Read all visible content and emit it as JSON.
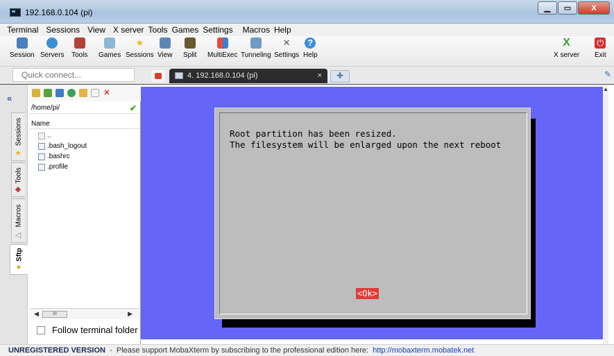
{
  "window": {
    "title": "192.168.0.104 (pi)",
    "minimize": "▁",
    "maximize": "▭",
    "close": "X"
  },
  "menu": [
    "Terminal",
    "Sessions",
    "View",
    "X server",
    "Tools",
    "Games",
    "Settings",
    "Macros",
    "Help"
  ],
  "toolbar": {
    "session": "Session",
    "servers": "Servers",
    "tools": "Tools",
    "games": "Games",
    "sessions": "Sessions",
    "view": "View",
    "split": "Split",
    "multiexec": "MultiExec",
    "tunneling": "Tunneling",
    "settings": "Settings",
    "help": "Help",
    "xserver": "X server",
    "exit": "Exit"
  },
  "quick_connect": {
    "placeholder": "Quick connect..."
  },
  "tabs": {
    "session_label": "4. 192.168.0.104 (pi)",
    "close": "×",
    "new_tab": "✚"
  },
  "side_tabs": {
    "sessions": "Sessions",
    "tools": "Tools",
    "macros": "Macros",
    "sftp": "Sftp",
    "collapse": "«"
  },
  "sftp": {
    "path": "/home/pi/",
    "column_name": "Name",
    "files": [
      "..",
      ".bash_logout",
      ".bashrc",
      ".profile"
    ],
    "scroll_thumb": "III",
    "follow_label": "Follow terminal folder"
  },
  "terminal": {
    "line1": "Root partition has been resized.",
    "line2": "The filesystem will be enlarged upon the next reboot",
    "ok_button": "<Ok>"
  },
  "status": {
    "unregistered": "UNREGISTERED VERSION",
    "message": "  -  Please support MobaXterm by subscribing to the professional edition here:  ",
    "link": "http://mobaxterm.mobatek.net"
  }
}
